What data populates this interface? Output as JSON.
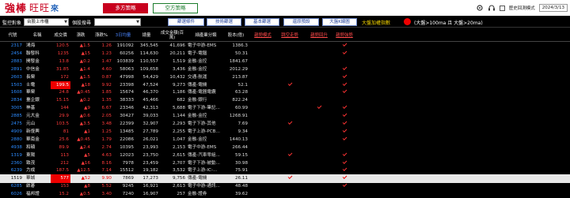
{
  "header": {
    "brand_main": "強棒",
    "brand_sub": "旺旺",
    "brand_sub2": "來",
    "tab_bull": "多方策略",
    "tab_bear": "空方策略",
    "history_label": "歷史回測模式",
    "date": "2024/3/13"
  },
  "toolbar": {
    "monitor_label": "監控對象",
    "monitor_value": "台股上市櫃",
    "search_label": "個股搜尋",
    "search_value": "",
    "btn_filter": "篩選條件",
    "btn_technical": "技術篩選",
    "btn_fundamental": "基本篩選",
    "btn_reset": "還原預設",
    "btn_bigk": "大盤K線圖",
    "bigmarket_label": "大盤加權指數",
    "market_condition": "(大盤>100ma 且 大盤>20ma)"
  },
  "columns": [
    "代號",
    "名稱",
    "成交價",
    "漲跌",
    "漲跌%",
    "3日均量",
    "總量",
    "成交金額(百萬)",
    "細產業分類",
    "股本(億)",
    "趨勢模式",
    "跳空走勢",
    "趨勢回升",
    "趨勢強勢"
  ],
  "rows": [
    {
      "code": "2317",
      "name": "鴻海",
      "price": "120.5",
      "chg": "▲1.5",
      "pct": "1.26",
      "vol3": "191092",
      "vol": "345,545",
      "amt": "41,696",
      "ind": "電子中游-EMS",
      "pe": "1386.3",
      "dir": "up",
      "hl": false,
      "m": [
        0,
        0,
        0,
        1
      ]
    },
    {
      "code": "2454",
      "name": "聯發科",
      "price": "1235",
      "chg": "▲15",
      "pct": "1.23",
      "vol3": "60256",
      "vol": "114,630",
      "amt": "20,211",
      "ind": "電子-電腦",
      "pe": "50.31",
      "dir": "up",
      "hl": false,
      "m": [
        0,
        0,
        0,
        1
      ]
    },
    {
      "code": "2883",
      "name": "開發金",
      "price": "13.8",
      "chg": "▲0.2",
      "pct": "1.47",
      "vol3": "103839",
      "vol": "110,557",
      "amt": "1,519",
      "ind": "金融-金控",
      "pe": "1841.67",
      "dir": "up",
      "hl": false,
      "m": [
        0,
        0,
        0,
        0
      ]
    },
    {
      "code": "2891",
      "name": "中信金",
      "price": "31.85",
      "chg": "▲1.4",
      "pct": "4.60",
      "vol3": "58063",
      "vol": "109,658",
      "amt": "3,436",
      "ind": "金融-金控",
      "pe": "2012.29",
      "dir": "up",
      "hl": false,
      "m": [
        0,
        0,
        0,
        1
      ]
    },
    {
      "code": "2603",
      "name": "長榮",
      "price": "172",
      "chg": "▲1.5",
      "pct": "0.87",
      "vol3": "47998",
      "vol": "54,429",
      "amt": "10,432",
      "ind": "交通-航運",
      "pe": "213.87",
      "dir": "up",
      "hl": false,
      "m": [
        0,
        0,
        0,
        1
      ]
    },
    {
      "code": "1503",
      "name": "士電",
      "price": "199.5",
      "chg": "▲18",
      "pct": "9.92",
      "vol3": "23398",
      "vol": "47,524",
      "amt": "9,273",
      "ind": "傳產-電機",
      "pe": "52.1",
      "dir": "up",
      "hl": true,
      "m": [
        0,
        1,
        0,
        1
      ]
    },
    {
      "code": "1608",
      "name": "華榮",
      "price": "24.8",
      "chg": "▲0.45",
      "pct": "1.85",
      "vol3": "15674",
      "vol": "46,370",
      "amt": "1,186",
      "ind": "傳產-電器電纜",
      "pe": "63.28",
      "dir": "up",
      "hl": false,
      "m": [
        0,
        0,
        0,
        1
      ]
    },
    {
      "code": "2834",
      "name": "臺企銀",
      "price": "15.15",
      "chg": "▲0.2",
      "pct": "1.35",
      "vol3": "38333",
      "vol": "45,466",
      "amt": "682",
      "ind": "金融-銀行",
      "pe": "822.24",
      "dir": "up",
      "hl": false,
      "m": [
        0,
        0,
        0,
        0
      ]
    },
    {
      "code": "3005",
      "name": "神基",
      "price": "144",
      "chg": "▲9",
      "pct": "6.67",
      "vol3": "23346",
      "vol": "42,313",
      "amt": "5,688",
      "ind": "電子下游-筆記...",
      "pe": "60.99",
      "dir": "up",
      "hl": false,
      "m": [
        0,
        0,
        1,
        1
      ]
    },
    {
      "code": "2885",
      "name": "元大金",
      "price": "29.9",
      "chg": "▲0.6",
      "pct": "2.05",
      "vol3": "30427",
      "vol": "39,033",
      "amt": "1,144",
      "ind": "金融-金控",
      "pe": "1268.91",
      "dir": "up",
      "hl": false,
      "m": [
        0,
        0,
        0,
        1
      ]
    },
    {
      "code": "2475",
      "name": "元山",
      "price": "103.5",
      "chg": "▲3.5",
      "pct": "3.48",
      "vol3": "22399",
      "vol": "32,907",
      "amt": "2,293",
      "ind": "電子下游-其他",
      "pe": "7.69",
      "dir": "up",
      "hl": false,
      "m": [
        0,
        1,
        0,
        1
      ]
    },
    {
      "code": "4909",
      "name": "新復興",
      "price": "81",
      "chg": "▲1",
      "pct": "1.25",
      "vol3": "13485",
      "vol": "27,789",
      "amt": "2,255",
      "ind": "電子上游-PCB...",
      "pe": "9.34",
      "dir": "up",
      "hl": false,
      "m": [
        0,
        0,
        0,
        1
      ]
    },
    {
      "code": "2880",
      "name": "華南金",
      "price": "25.6",
      "chg": "▲0.45",
      "pct": "1.79",
      "vol3": "22086",
      "vol": "26,021",
      "amt": "1,047",
      "ind": "金融-金控",
      "pe": "1440.13",
      "dir": "up",
      "hl": false,
      "m": [
        0,
        0,
        0,
        1
      ]
    },
    {
      "code": "4938",
      "name": "和碩",
      "price": "89.9",
      "chg": "▲2.4",
      "pct": "2.74",
      "vol3": "10395",
      "vol": "23,993",
      "amt": "2,153",
      "ind": "電子中游-EMS",
      "pe": "266.44",
      "dir": "up",
      "hl": false,
      "m": [
        0,
        0,
        0,
        0
      ]
    },
    {
      "code": "1319",
      "name": "東陽",
      "price": "113",
      "chg": "▲5",
      "pct": "4.63",
      "vol3": "12023",
      "vol": "23,750",
      "amt": "2,615",
      "ind": "傳產-汽車零組...",
      "pe": "59.15",
      "dir": "up",
      "hl": false,
      "m": [
        0,
        1,
        0,
        1
      ]
    },
    {
      "code": "2360",
      "name": "致茂",
      "price": "212",
      "chg": "▲16",
      "pct": "8.16",
      "vol3": "7978",
      "vol": "23,459",
      "amt": "2,707",
      "ind": "電子下游-被動...",
      "pe": "30.98",
      "dir": "up",
      "hl": false,
      "m": [
        0,
        0,
        0,
        1
      ]
    },
    {
      "code": "6239",
      "name": "力成",
      "price": "187.5",
      "chg": "▲12.5",
      "pct": "7.14",
      "vol3": "15512",
      "vol": "19,182",
      "amt": "3,532",
      "ind": "電子上游-IC-...",
      "pe": "75.91",
      "dir": "up",
      "hl": false,
      "m": [
        0,
        0,
        0,
        1
      ]
    },
    {
      "code": "1519",
      "name": "華城",
      "price": "577",
      "chg": "▲52",
      "pct": "9.90",
      "vol3": "7869",
      "vol": "17,273",
      "amt": "9,756",
      "ind": "傳產-電機",
      "pe": "26.11",
      "dir": "up",
      "hl": true,
      "m": [
        0,
        1,
        0,
        1
      ]
    },
    {
      "code": "6285",
      "name": "啟碁",
      "price": "153",
      "chg": "▲8",
      "pct": "5.52",
      "vol3": "9245",
      "vol": "16,921",
      "amt": "2,613",
      "ind": "電子中游-通訊...",
      "pe": "48.48",
      "dir": "up",
      "hl": false,
      "m": [
        0,
        0,
        0,
        1
      ]
    },
    {
      "code": "6026",
      "name": "福邦證",
      "price": "15.2",
      "chg": "▲0.5",
      "pct": "3.40",
      "vol3": "7240",
      "vol": "16,907",
      "amt": "257",
      "ind": "金融-證券",
      "pe": "39.62",
      "dir": "up",
      "hl": false,
      "m": [
        0,
        0,
        0,
        0
      ]
    }
  ],
  "selected_row": 17,
  "colors": {
    "up": "#ff3c3c",
    "down": "#1ed21e",
    "code": "#2c8bff",
    "accent": "#c8001e"
  }
}
